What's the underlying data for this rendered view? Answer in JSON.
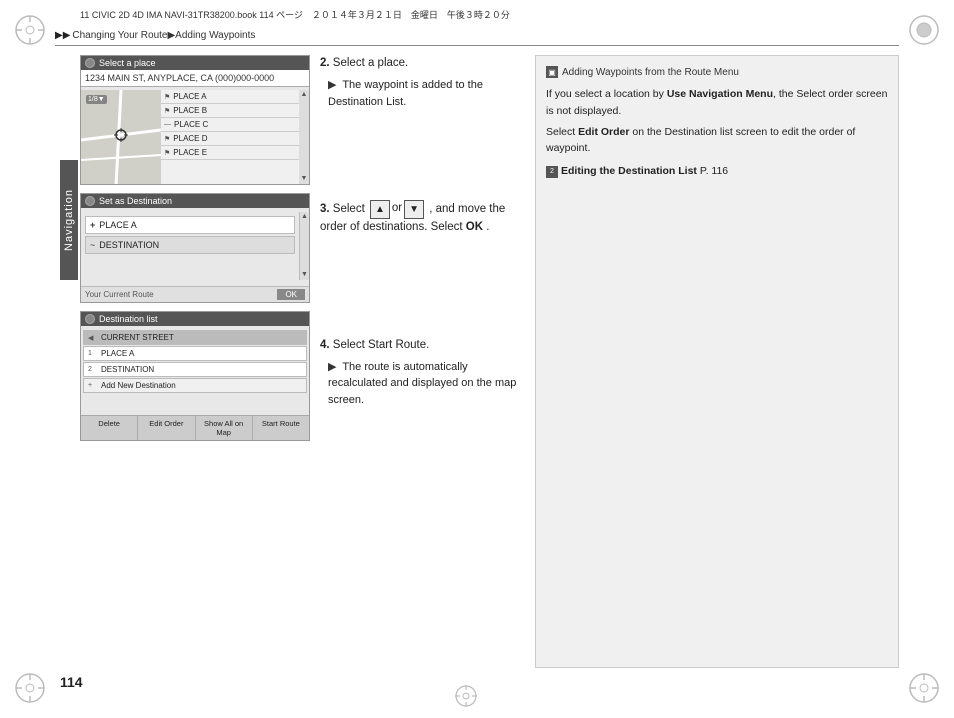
{
  "header": {
    "print_info": "11 CIVIC 2D 4D IMA NAVI-31TR38200.book  114 ページ　２０１４年３月２１日　金曜日　午後３時２０分",
    "breadcrumb_arrows": "▶▶",
    "breadcrumb_text": "Changing Your Route▶Adding Waypoints"
  },
  "page_number": "114",
  "nav_label": "Navigation",
  "screens": {
    "screen1": {
      "title": "Select a place",
      "address": "1234 MAIN ST, ANYPLACE, CA (000)000-0000",
      "map_indicator": "1/8▼",
      "places": [
        "PLACE A",
        "PLACE B",
        "PLACE C",
        "PLACE D",
        "PLACE E"
      ]
    },
    "screen2": {
      "title": "Set as Destination",
      "items": [
        {
          "icon": "+",
          "label": "PLACE A"
        },
        {
          "icon": "~",
          "label": "DESTINATION"
        }
      ],
      "bottom_left": "Your Current Route",
      "ok_button": "OK"
    },
    "screen3": {
      "title": "Destination list",
      "items": [
        {
          "num": "◀",
          "label": "CURRENT STREET",
          "type": "current"
        },
        {
          "num": "1",
          "label": "PLACE A",
          "type": "normal"
        },
        {
          "num": "2",
          "label": "DESTINATION",
          "type": "normal"
        },
        {
          "num": "+",
          "label": "Add New Destination",
          "type": "add"
        }
      ],
      "buttons": [
        "Delete",
        "Edit Order",
        "Show All on Map",
        "Start Route"
      ]
    }
  },
  "instructions": {
    "step2": {
      "number": "2.",
      "text": "Select a place.",
      "sub": "The waypoint is added to the Destination List."
    },
    "step3": {
      "number": "3.",
      "text_pre": "Select ",
      "btn_up": "▲",
      "text_mid": " or ",
      "btn_down": "▼",
      "text_post": ", and move the order of destinations. Select ",
      "ok_bold": "OK",
      "period": "."
    },
    "step4": {
      "number": "4.",
      "text": "Select Start Route.",
      "sub": "The route is automatically recalculated and displayed on the map screen."
    }
  },
  "note": {
    "title": "Adding Waypoints from the Route Menu",
    "body1": "If you select a location by ",
    "body1_bold": "Use Navigation Menu",
    "body2": ", the Select order screen is not displayed.",
    "body3_pre": "Select ",
    "body3_bold": "Edit Order",
    "body3_post": " on the Destination list screen to edit the order of waypoint.",
    "link_prefix": "2",
    "link_bold": "Editing the Destination List",
    "link_page": " P. 116"
  },
  "colors": {
    "screen_bg": "#e8e8e8",
    "titlebar": "#555555",
    "highlight": "#bbbbbb",
    "note_bg": "#f0f0f0",
    "nav_bg": "#555555"
  }
}
